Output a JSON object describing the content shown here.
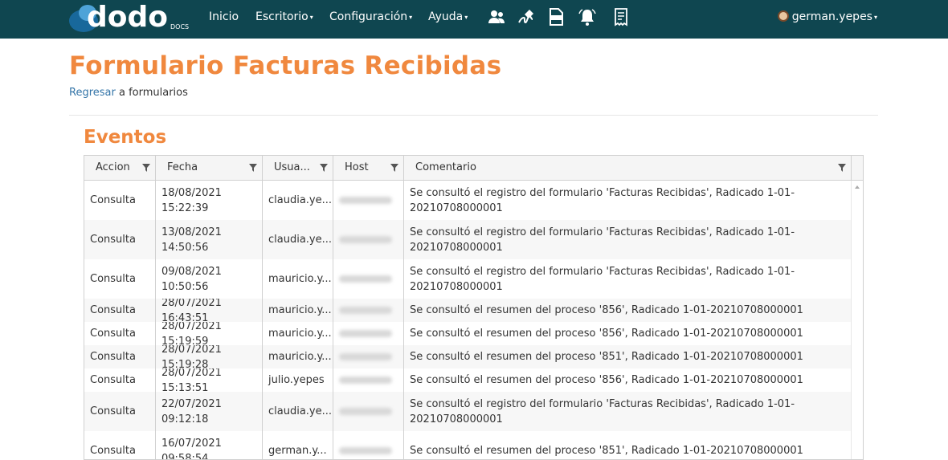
{
  "nav": {
    "logo_text": "dodo",
    "logo_sub": "DOCS",
    "items": [
      {
        "label": "Inicio",
        "caret": ""
      },
      {
        "label": "Escritorio",
        "caret": "▾"
      },
      {
        "label": "Configuración",
        "caret": "▾"
      },
      {
        "label": "Ayuda",
        "caret": "▾"
      }
    ],
    "icons": [
      "users-icon",
      "signature-icon",
      "xlsx-file-icon",
      "bell-icon",
      "receipt-icon"
    ],
    "user": "german.yepes",
    "user_caret": "▾"
  },
  "page": {
    "title": "Formulario Facturas Recibidas",
    "back_link": "Regresar",
    "back_rest": " a formularios",
    "section_title": "Eventos"
  },
  "table": {
    "columns": [
      "Accion",
      "Fecha",
      "Usua...",
      "Host",
      "Comentario"
    ],
    "rows": [
      {
        "accion": "Consulta",
        "fecha": "18/08/2021 15:22:39",
        "usuario": "claudia.ye...",
        "comentario": "Se consultó el registro del formulario 'Facturas Recibidas', Radicado 1-01-20210708000001"
      },
      {
        "accion": "Consulta",
        "fecha": "13/08/2021 14:50:56",
        "usuario": "claudia.ye...",
        "comentario": "Se consultó el registro del formulario 'Facturas Recibidas', Radicado 1-01-20210708000001"
      },
      {
        "accion": "Consulta",
        "fecha": "09/08/2021 10:50:56",
        "usuario": "mauricio.y...",
        "comentario": "Se consultó el registro del formulario 'Facturas Recibidas', Radicado 1-01-20210708000001"
      },
      {
        "accion": "Consulta",
        "fecha": "28/07/2021 16:43:51",
        "usuario": "mauricio.y...",
        "comentario": "Se consultó el resumen del proceso '856', Radicado 1-01-20210708000001"
      },
      {
        "accion": "Consulta",
        "fecha": "28/07/2021 15:19:59",
        "usuario": "mauricio.y...",
        "comentario": "Se consultó el resumen del proceso '856', Radicado 1-01-20210708000001"
      },
      {
        "accion": "Consulta",
        "fecha": "28/07/2021 15:19:28",
        "usuario": "mauricio.y...",
        "comentario": "Se consultó el resumen del proceso '851', Radicado 1-01-20210708000001"
      },
      {
        "accion": "Consulta",
        "fecha": "28/07/2021 15:13:51",
        "usuario": "julio.yepes",
        "comentario": "Se consultó el resumen del proceso '856', Radicado 1-01-20210708000001"
      },
      {
        "accion": "Consulta",
        "fecha": "22/07/2021 09:12:18",
        "usuario": "claudia.ye...",
        "comentario": "Se consultó el registro del formulario 'Facturas Recibidas', Radicado 1-01-20210708000001"
      },
      {
        "accion": "Consulta",
        "fecha": "16/07/2021 09:58:54",
        "usuario": "german.y...",
        "comentario": "Se consultó el resumen del proceso '851', Radicado 1-01-20210708000001"
      }
    ]
  },
  "colors": {
    "navbar": "#0f4650",
    "accent": "#f0883e",
    "link": "#3475a8"
  }
}
